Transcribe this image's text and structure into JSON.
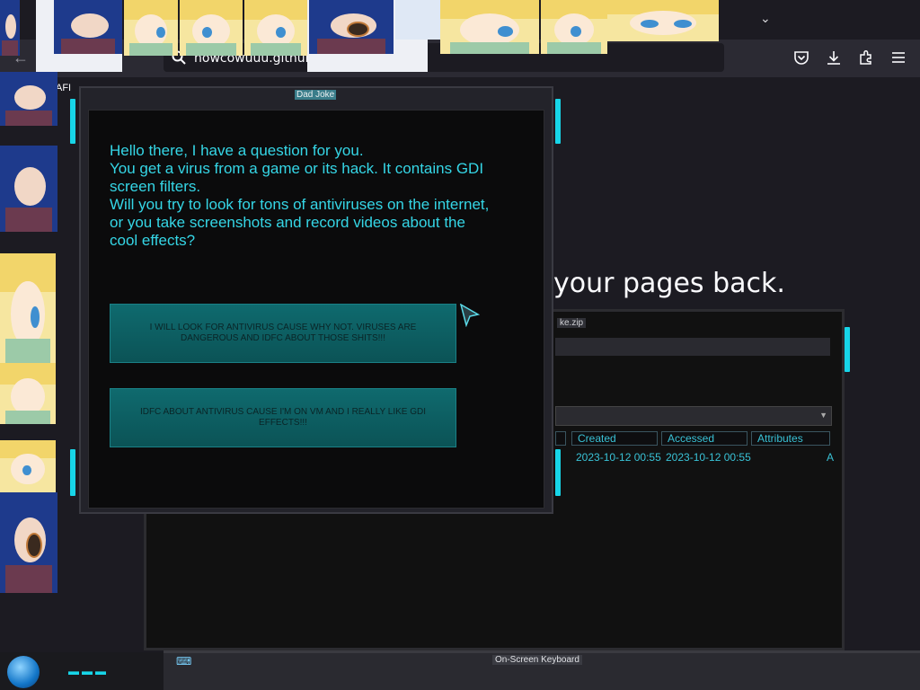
{
  "browser": {
    "url": "howcowuuu.github.io/DadJoke.zip",
    "background_fragment": "AFI",
    "restore_message": "your pages back."
  },
  "dialog": {
    "title": "Dad Joke",
    "question": "Hello there, I have a question for you.\nYou get a virus from a game or its hack. It contains GDI screen filters.\nWill you try to look for tons of antiviruses on the internet, or you take screenshots and record videos about the cool effects?",
    "choice_1": "I WILL LOOK FOR ANTIVIRUS CAUSE WHY NOT. VIRUSES ARE DANGEROUS AND IDFC ABOUT THOSE SHITS!!!",
    "choice_2": "IDFC ABOUT ANTIVIRUS CAUSE I'M ON VM AND I REALLY LIKE GDI EFFECTS!!!"
  },
  "explorer": {
    "title": "ke.zip",
    "columns": [
      "Created",
      "Accessed",
      "Attributes"
    ],
    "row": {
      "created": "2023-10-12 00:55",
      "accessed": "2023-10-12 00:55",
      "attributes": "A"
    }
  },
  "taskbar": {
    "osk_title": "On-Screen Keyboard"
  },
  "colors": {
    "accent": "#17d5e8",
    "question_text": "#35d6e6"
  }
}
